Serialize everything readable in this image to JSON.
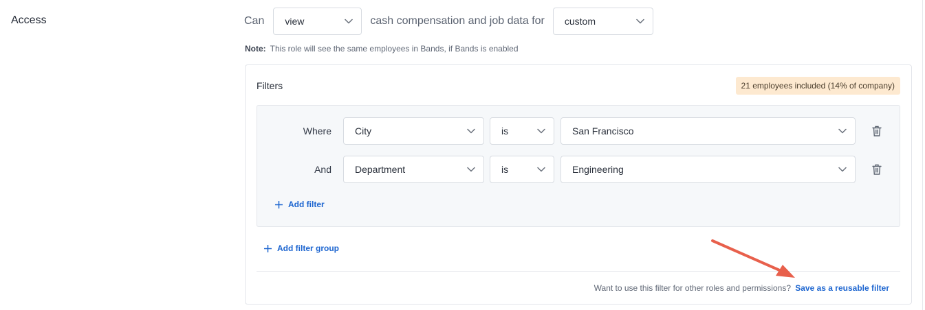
{
  "section": {
    "label": "Access"
  },
  "access": {
    "can_text": "Can",
    "mode": "view",
    "mid_text": "cash compensation and job data for",
    "scope": "custom"
  },
  "note": {
    "label": "Note:",
    "text": "This role will see the same employees in Bands, if Bands is enabled"
  },
  "filters": {
    "title": "Filters",
    "badge": "21 employees included (14% of company)",
    "conditions": [
      {
        "connector": "Where",
        "field": "City",
        "operator": "is",
        "value": "San Francisco"
      },
      {
        "connector": "And",
        "field": "Department",
        "operator": "is",
        "value": "Engineering"
      }
    ],
    "add_filter": "Add filter",
    "add_filter_group": "Add filter group"
  },
  "footer": {
    "question": "Want to use this filter for other roles and permissions?",
    "save_link": "Save as a reusable filter"
  },
  "icons": {
    "chevron": "chevron-down-icon",
    "trash": "trash-icon",
    "plus": "plus-icon",
    "arrow": "annotation-arrow"
  },
  "colors": {
    "link": "#1e66d0",
    "badge_bg": "#fde9d0",
    "arrow": "#e8604c",
    "group_bg": "#f6f8fa"
  }
}
